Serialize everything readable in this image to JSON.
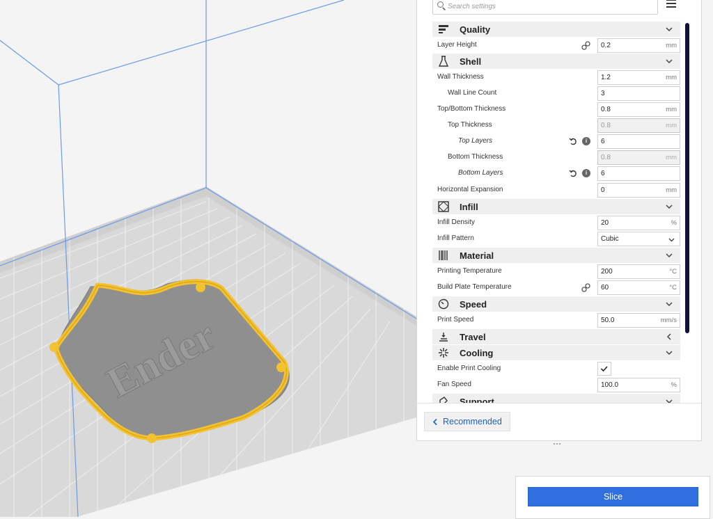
{
  "search": {
    "placeholder": "Search settings"
  },
  "categories": {
    "quality": "Quality",
    "shell": "Shell",
    "infill": "Infill",
    "material": "Material",
    "speed": "Speed",
    "travel": "Travel",
    "cooling": "Cooling",
    "support": "Support"
  },
  "settings": {
    "layer_height": {
      "label": "Layer Height",
      "value": "0.2",
      "unit": "mm"
    },
    "wall_thickness": {
      "label": "Wall Thickness",
      "value": "1.2",
      "unit": "mm"
    },
    "wall_line_count": {
      "label": "Wall Line Count",
      "value": "3"
    },
    "top_bottom_thickness": {
      "label": "Top/Bottom Thickness",
      "value": "0.8",
      "unit": "mm"
    },
    "top_thickness": {
      "label": "Top Thickness",
      "value": "0.8",
      "unit": "mm"
    },
    "top_layers": {
      "label": "Top Layers",
      "value": "6"
    },
    "bottom_thickness": {
      "label": "Bottom Thickness",
      "value": "0.8",
      "unit": "mm"
    },
    "bottom_layers": {
      "label": "Bottom Layers",
      "value": "6"
    },
    "horizontal_expansion": {
      "label": "Horizontal Expansion",
      "value": "0",
      "unit": "mm"
    },
    "infill_density": {
      "label": "Infill Density",
      "value": "20",
      "unit": "%"
    },
    "infill_pattern": {
      "label": "Infill Pattern",
      "value": "Cubic"
    },
    "printing_temperature": {
      "label": "Printing Temperature",
      "value": "200",
      "unit": "°C"
    },
    "build_plate_temperature": {
      "label": "Build Plate Temperature",
      "value": "60",
      "unit": "°C"
    },
    "print_speed": {
      "label": "Print Speed",
      "value": "50.0",
      "unit": "mm/s"
    },
    "enable_print_cooling": {
      "label": "Enable Print Cooling",
      "checked": true
    },
    "fan_speed": {
      "label": "Fan Speed",
      "value": "100.0",
      "unit": "%"
    }
  },
  "buttons": {
    "recommended": "Recommended",
    "slice": "Slice"
  },
  "model": {
    "text": "Ender"
  },
  "colors": {
    "accent": "#2f6fe0",
    "scrollbar": "#10103d",
    "model_outline": "#f2c230",
    "model_fill": "#8f8f8f"
  },
  "icons": {
    "quality": "quality-lines-icon",
    "shell": "flask-icon",
    "infill": "infill-grid-icon",
    "material": "barcode-icon",
    "speed": "clock-icon",
    "travel": "travel-icon",
    "cooling": "fan-icon",
    "support": "support-icon"
  }
}
